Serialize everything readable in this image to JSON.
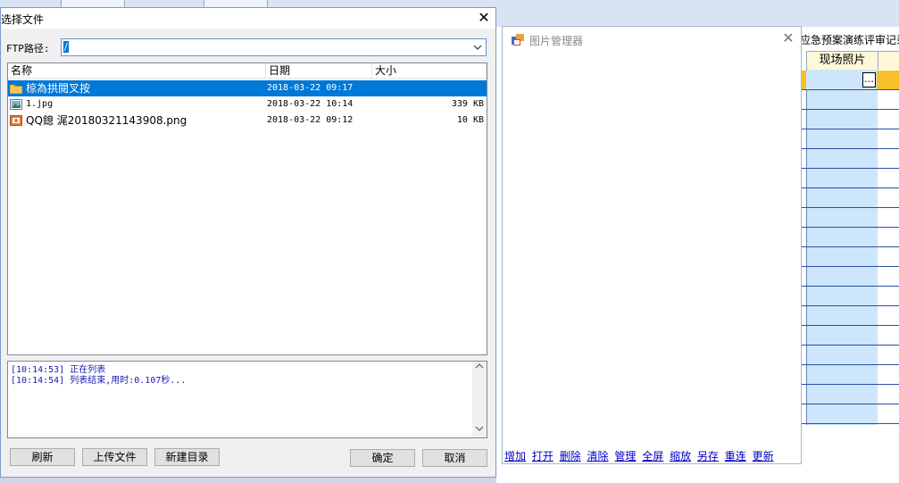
{
  "background_app": {
    "title_partial": "应急预案演练评审记录",
    "column_header": "现场照片",
    "ellipsis": "…",
    "colors": {
      "grid_cell": "#cde6fb",
      "selected_row": "#f5c02a",
      "grid_line": "#2b4fa3"
    }
  },
  "file_dialog": {
    "title": "选择文件",
    "close": "✕",
    "ftp_label": "FTP路径:",
    "ftp_value": "/",
    "columns": [
      "名称",
      "日期",
      "大小"
    ],
    "files": [
      {
        "icon": "folder-icon",
        "name": "椋為拱閱叉按",
        "date": "2018-03-22 09:17",
        "size": "",
        "selected": true
      },
      {
        "icon": "image-file-icon",
        "name": "1.jpg",
        "date": "2018-03-22 10:14",
        "size": "339 KB",
        "selected": false
      },
      {
        "icon": "png-file-icon",
        "name": "QQ鎴   浘20180321143908.png",
        "date": "2018-03-22 09:12",
        "size": "10 KB",
        "selected": false
      }
    ],
    "log": [
      "[10:14:53] 正在列表",
      "[10:14:54] 列表结束,用时:0.107秒..."
    ],
    "buttons": {
      "refresh": "刷新",
      "upload": "上传文件",
      "new_folder": "新建目录",
      "ok": "确定",
      "cancel": "取消"
    },
    "colors": {
      "selection": "#0078d7",
      "log_text": "#1a1ab0"
    }
  },
  "image_manager": {
    "title": "图片管理器",
    "close": "✕",
    "links": [
      "增加",
      "打开",
      "删除",
      "清除",
      "管理",
      "全屏",
      "缩放",
      "另存",
      "重连",
      "更新"
    ]
  }
}
